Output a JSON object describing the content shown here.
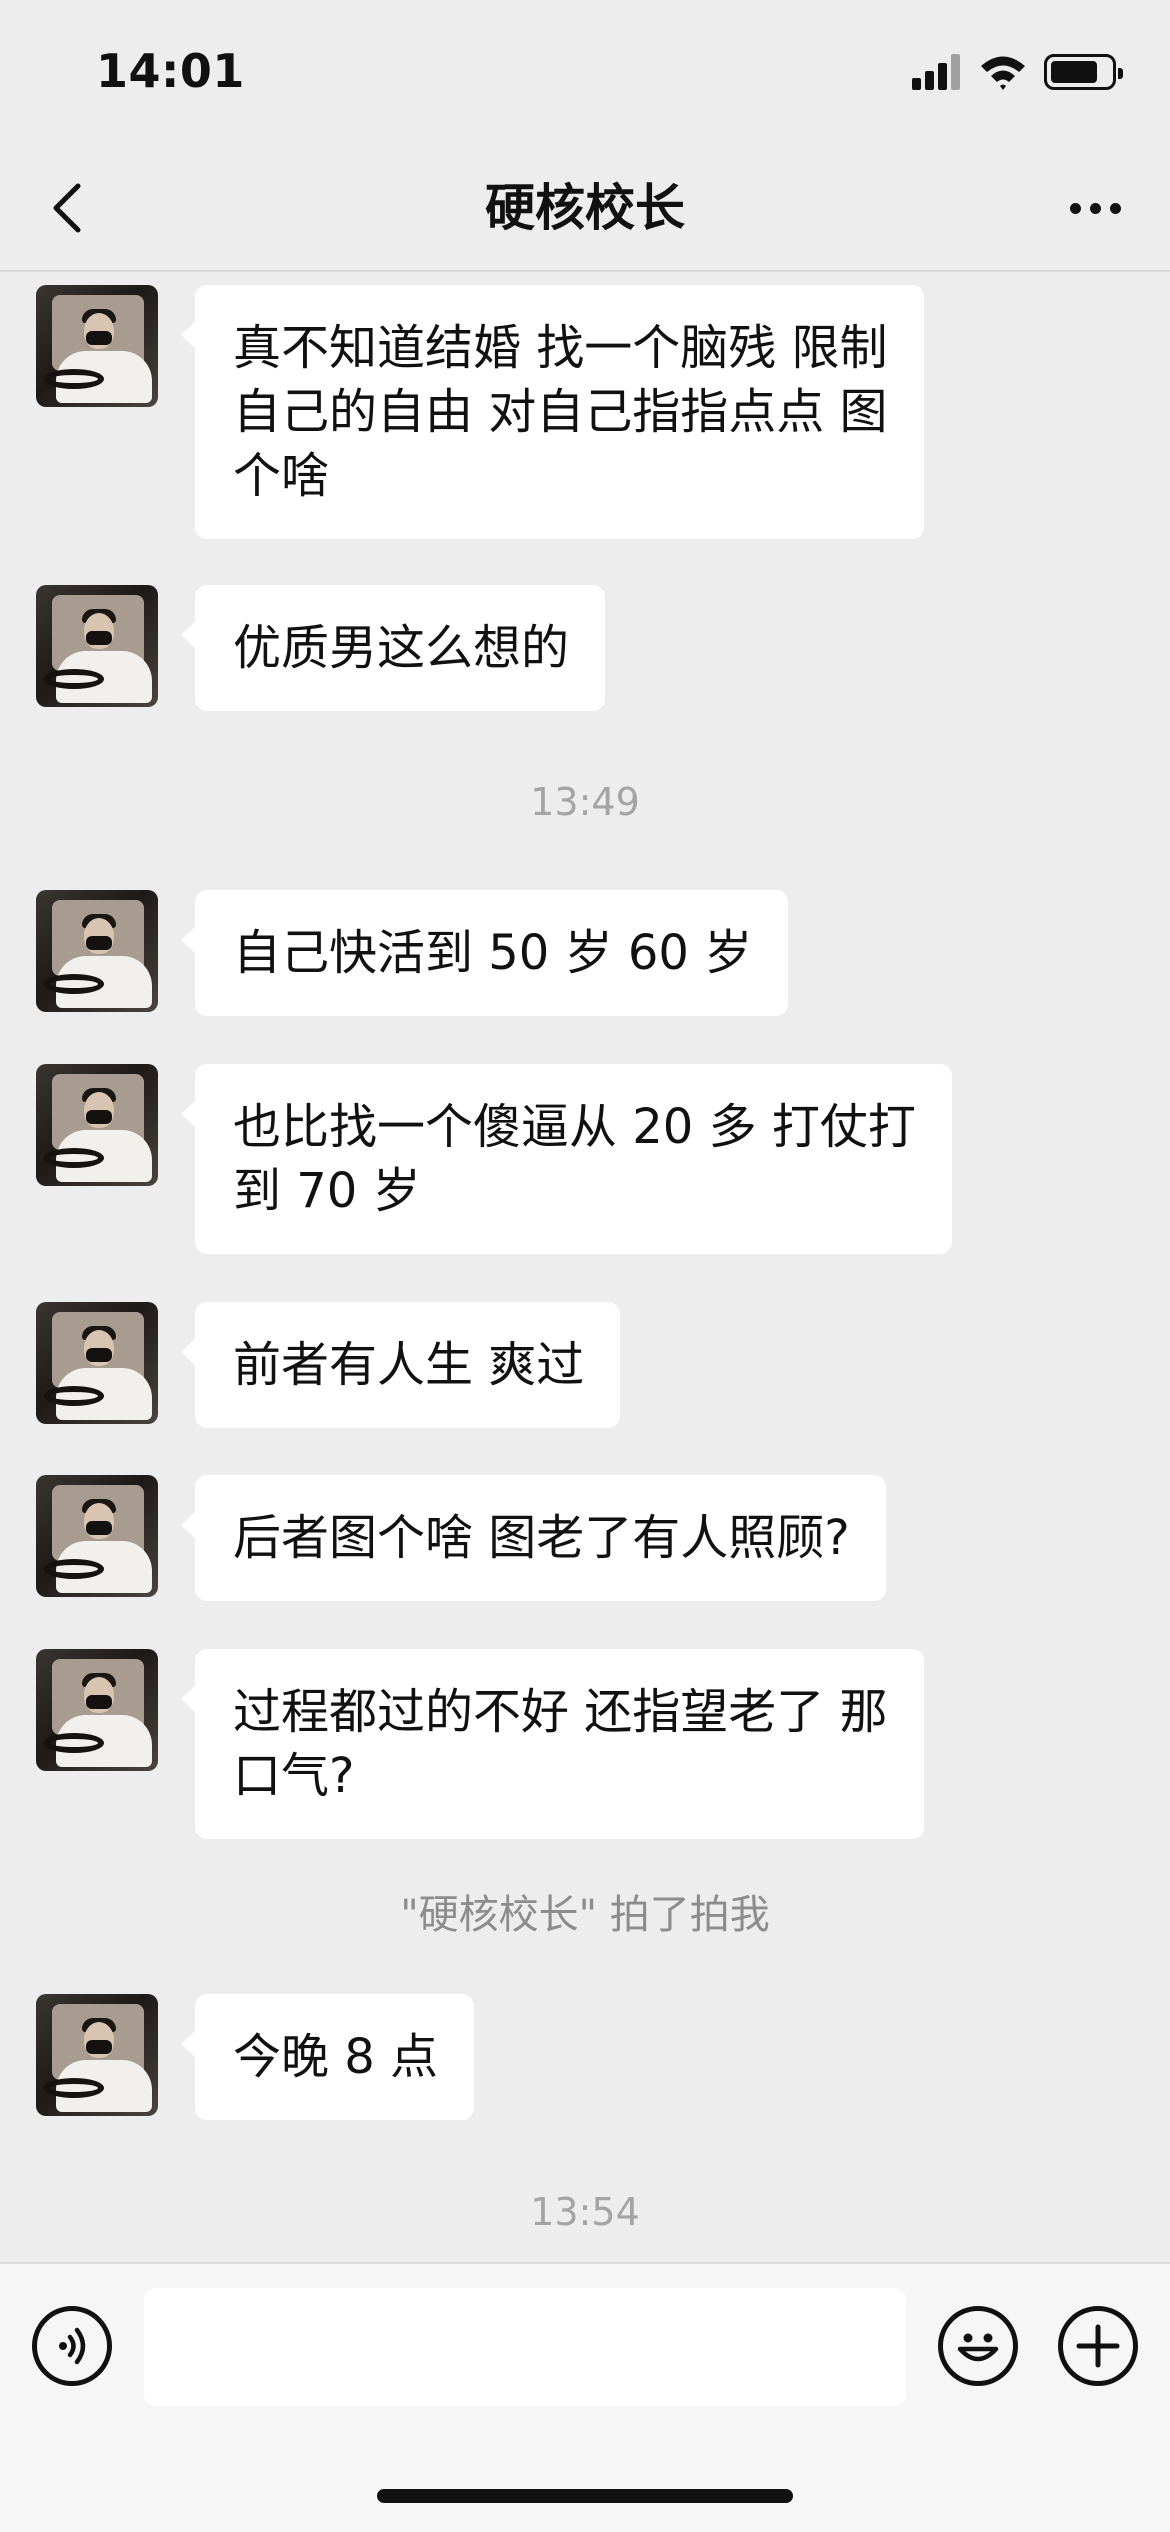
{
  "status_bar": {
    "time": "14:01",
    "icons": [
      "signal-icon",
      "wifi-icon",
      "battery-icon"
    ]
  },
  "nav": {
    "title": "硬核校长",
    "back_icon": "chevron-left-icon",
    "more_icon": "more-dots-icon"
  },
  "messages": [
    {
      "kind": "message",
      "sender": "other",
      "lines": [
        "真不知道结婚 找一个脑残 限制",
        "自己的自由 对自己指指点点 图",
        "个啥"
      ]
    },
    {
      "kind": "message",
      "sender": "other",
      "lines": [
        "优质男这么想的"
      ]
    },
    {
      "kind": "timestamp",
      "text": "13:49"
    },
    {
      "kind": "message",
      "sender": "other",
      "lines": [
        "自己快活到 50 岁 60 岁"
      ]
    },
    {
      "kind": "message",
      "sender": "other",
      "lines": [
        "也比找一个傻逼从 20 多 打仗打",
        "到 70 岁"
      ]
    },
    {
      "kind": "message",
      "sender": "other",
      "lines": [
        "前者有人生 爽过"
      ]
    },
    {
      "kind": "message",
      "sender": "other",
      "lines": [
        "后者图个啥 图老了有人照顾?"
      ]
    },
    {
      "kind": "message",
      "sender": "other",
      "lines": [
        "过程都过的不好 还指望老了 那",
        "口气?"
      ]
    },
    {
      "kind": "system",
      "text": "\"硬核校长\" 拍了拍我"
    },
    {
      "kind": "message",
      "sender": "other",
      "lines": [
        "今晚 8 点"
      ]
    },
    {
      "kind": "timestamp",
      "text": "13:54"
    }
  ],
  "input_bar": {
    "voice_icon": "voice-icon",
    "text_value": "",
    "emoji_icon": "emoji-icon",
    "plus_icon": "plus-icon"
  },
  "colors": {
    "background": "#ededed",
    "bubble": "#ffffff",
    "timestamp_text": "#a4a4a4",
    "input_bar": "#f6f6f6"
  }
}
